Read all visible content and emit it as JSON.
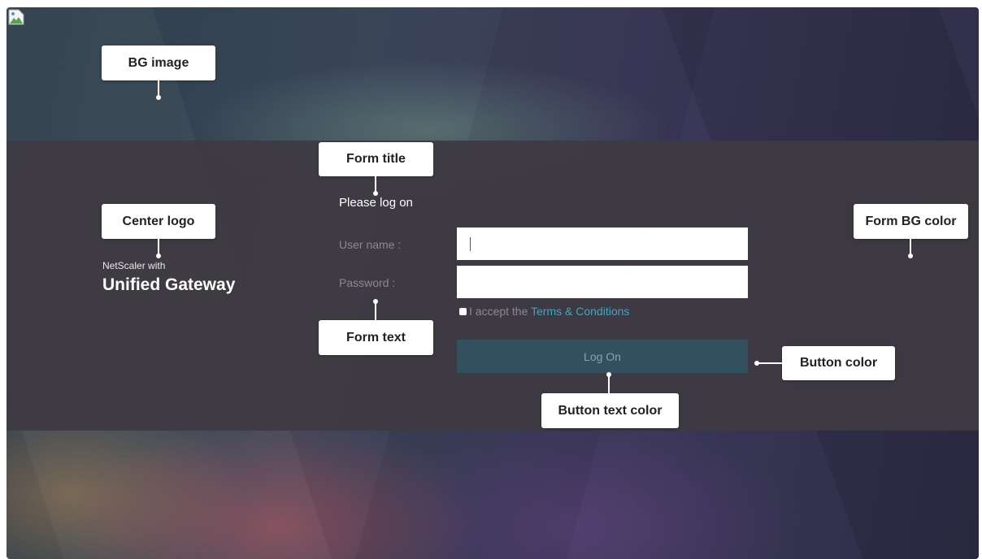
{
  "center_logo": {
    "line1": "NetScaler with",
    "line2": "Unified Gateway"
  },
  "form": {
    "title": "Please log on",
    "username_label": "User name :",
    "username_value": "",
    "password_label": "Password :",
    "password_value": "",
    "accept_text": "I accept the ",
    "terms_link": "Terms & Conditions",
    "logon_label": "Log On"
  },
  "callouts": {
    "bg_image": "BG image",
    "form_title": "Form title",
    "center_logo": "Center logo",
    "form_bg_color": "Form BG color",
    "form_text": "Form text",
    "button_color": "Button color",
    "button_text_color": "Button text color"
  },
  "colors": {
    "form_bg": "#3e3a42",
    "button": "#32505e",
    "button_text": "#8fa0aa",
    "link": "#3aa7c9"
  },
  "icons": {
    "broken_image": "broken-image-icon",
    "checkbox": "checkbox-icon"
  }
}
